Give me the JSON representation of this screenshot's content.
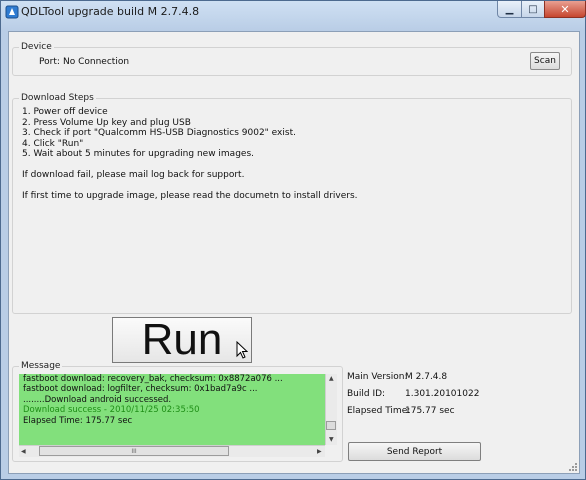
{
  "window": {
    "title": "QDLTool upgrade build M 2.7.4.8"
  },
  "device": {
    "group_label": "Device",
    "port_label": "Port:",
    "port_value": "No Connection",
    "scan_label": "Scan"
  },
  "steps": {
    "group_label": "Download Steps",
    "lines": [
      "1. Power off device",
      "2. Press Volume Up key and plug USB",
      "3. Check if port \"Qualcomm HS-USB Diagnostics 9002\" exist.",
      "4. Click \"Run\"",
      "5. Wait about 5 minutes for upgrading new images."
    ],
    "note1": "If download fail, please mail log back for support.",
    "note2": "If first time to upgrade image, please read the documetn to install drivers."
  },
  "run_label": "Run",
  "message": {
    "group_label": "Message",
    "log": [
      "fastboot download: recovery_bak, checksum: 0x8872a076 ...",
      "fastboot download: logfilter, checksum: 0x1bad7a9c ...",
      "........Download android successed.",
      "Download success - 2010/11/25 02:35:50",
      "Elapsed Time: 175.77 sec"
    ],
    "thumb_grip": "III"
  },
  "info": {
    "main_version_label": "Main Version:",
    "main_version_value": "M 2.7.4.8",
    "build_id_label": "Build ID:",
    "build_id_value": "1.301.20101022",
    "elapsed_label": "Elapsed Time:",
    "elapsed_value": "175.77 sec"
  },
  "report_label": "Send Report",
  "colors": {
    "log_background": "#82e07c",
    "success_text": "#1f8f17"
  }
}
